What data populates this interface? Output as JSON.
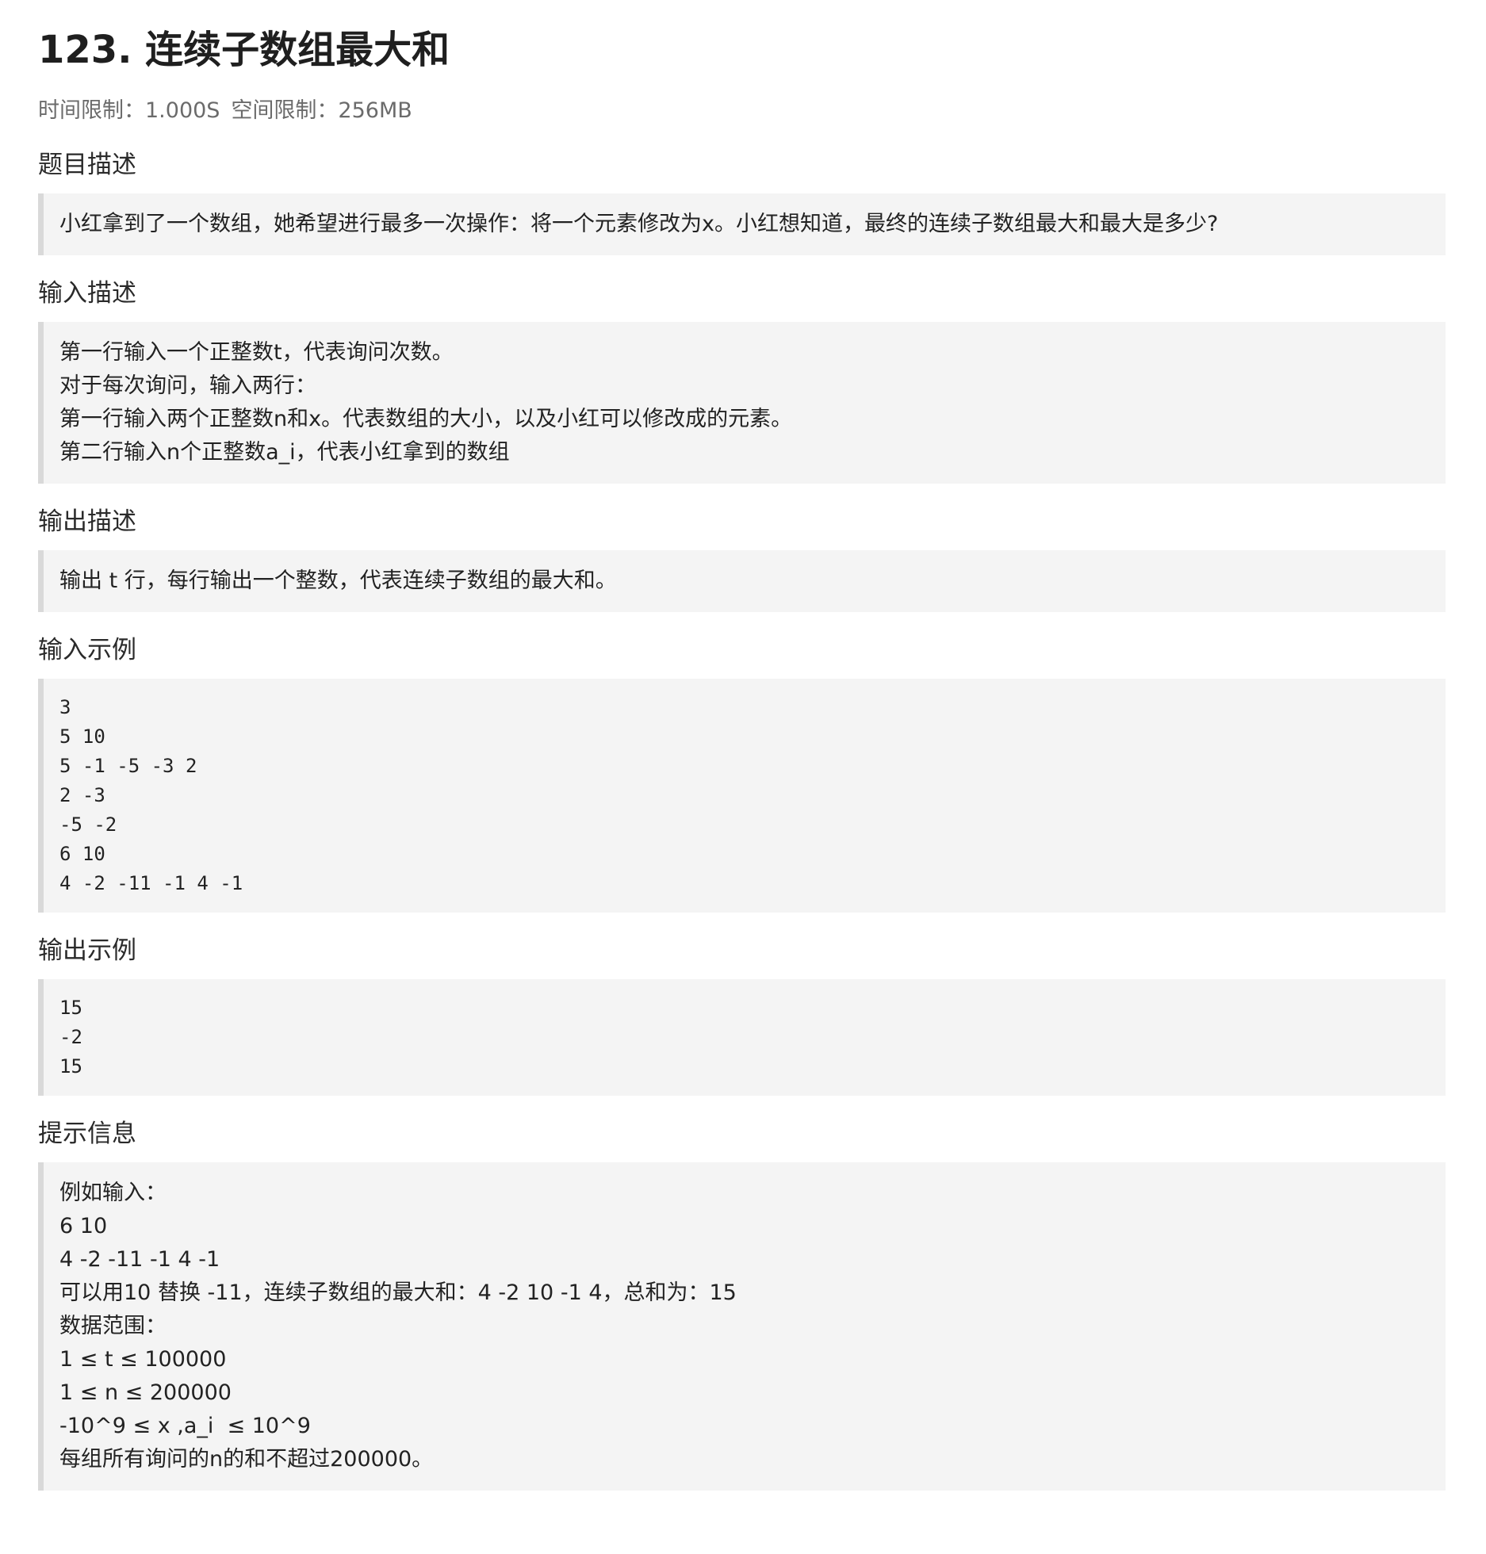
{
  "problem": {
    "title": "123. 连续子数组最大和",
    "time_limit": "时间限制：1.000S",
    "space_limit": "空间限制：256MB"
  },
  "sections": {
    "description": {
      "heading": "题目描述",
      "lines": [
        "小红拿到了一个数组，她希望进行最多一次操作：将一个元素修改为x。小红想知道，最终的连续子数组最大和最大是多少?"
      ]
    },
    "input": {
      "heading": "输入描述",
      "lines": [
        "第一行输入一个正整数t，代表询问次数。",
        "对于每次询问，输入两行：",
        "第一行输入两个正整数n和x。代表数组的大小，以及小红可以修改成的元素。",
        "第二行输入n个正整数a_i，代表小红拿到的数组"
      ]
    },
    "output": {
      "heading": "输出描述",
      "lines": [
        "输出 t 行，每行输出一个整数，代表连续子数组的最大和。"
      ]
    },
    "sample_input": {
      "heading": "输入示例",
      "lines": [
        "3",
        "5 10",
        "5 -1 -5 -3 2",
        "2 -3",
        "-5 -2",
        "6 10",
        "4 -2 -11 -1 4 -1"
      ]
    },
    "sample_output": {
      "heading": "输出示例",
      "lines": [
        "15",
        "-2",
        "15"
      ]
    },
    "hints": {
      "heading": "提示信息",
      "lines": [
        "例如输入：",
        "6 10",
        "4 -2 -11 -1 4 -1",
        "可以用10 替换 -11，连续子数组的最大和：4 -2 10 -1 4，总和为：15",
        "数据范围：",
        "1 ≤ t ≤ 100000",
        "1 ≤ n ≤ 200000",
        "-10^9 ≤ x ,a_i  ≤ 10^9",
        "每组所有询问的n的和不超过200000。"
      ]
    }
  }
}
